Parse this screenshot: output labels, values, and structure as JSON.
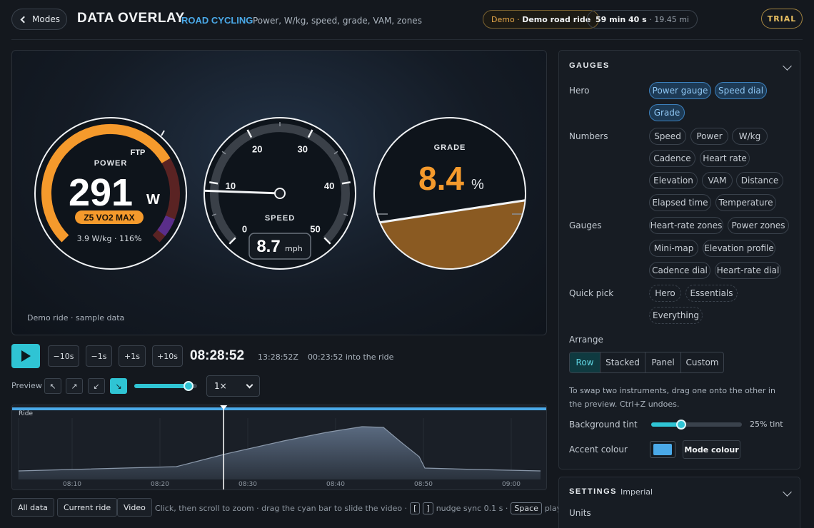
{
  "header": {
    "modes_label": "Modes",
    "title": "DATA OVERLAY",
    "sport": "ROAD CYCLING",
    "metrics": "Power, W/kg, speed, grade, VAM, zones",
    "demo_prefix": "Demo ·",
    "demo_name": "Demo road ride",
    "duration": "59 min 40 s",
    "distance": "· 19.45 mi",
    "trial": "TRIAL"
  },
  "preview": {
    "demo_note": "Demo ride · sample data",
    "power": {
      "label": "POWER",
      "ftp_label": "FTP",
      "value": "291",
      "unit": "W",
      "zone": "Z5 VO2 MAX",
      "detail": "3.9 W/kg · 116%",
      "fill_fraction": 0.72
    },
    "speed": {
      "label": "SPEED",
      "value": "8.7",
      "unit": "mph",
      "ticks": [
        "0",
        "10",
        "20",
        "30",
        "40",
        "50"
      ],
      "min": 0,
      "max": 50,
      "reading": 8.7
    },
    "grade": {
      "label": "GRADE",
      "value": "8.4",
      "unit": "%"
    }
  },
  "transport": {
    "back10": "−10s",
    "back1": "−1s",
    "fwd1": "+1s",
    "fwd10": "+10s",
    "clock": "08:28:52",
    "utc": "13:28:52Z",
    "into": "00:23:52 into the ride",
    "preview_label": "Preview",
    "positions": [
      "↖",
      "↗",
      "↙",
      "↘"
    ],
    "preview_size": 0.86,
    "speed_value": "1×"
  },
  "timeline": {
    "track_label": "Ride",
    "ticks": [
      "08:10",
      "08:20",
      "08:30",
      "08:40",
      "08:50",
      "09:00"
    ],
    "cursor_fraction": 0.395
  },
  "bottom": {
    "all_data": "All data",
    "current_ride": "Current ride",
    "video": "Video",
    "hint_a": "Click, then scroll to zoom · drag the cyan bar to slide the video ·",
    "key_open": "[",
    "key_close": "]",
    "hint_b": "nudge sync 0.1 s ·",
    "key_space": "Space",
    "hint_c": "play"
  },
  "gauges_panel": {
    "title": "GAUGES",
    "hero_label": "Hero",
    "hero": [
      "Power gauge",
      "Speed dial",
      "Grade"
    ],
    "numbers_label": "Numbers",
    "numbers": [
      "Speed",
      "Power",
      "W/kg",
      "Cadence",
      "Heart rate",
      "Elevation",
      "VAM",
      "Distance",
      "Elapsed time",
      "Temperature"
    ],
    "gauges_label": "Gauges",
    "gauges": [
      "Heart-rate zones",
      "Power zones",
      "Mini-map",
      "Elevation profile",
      "Cadence dial",
      "Heart-rate dial"
    ],
    "quick_label": "Quick pick",
    "quick": [
      "Hero",
      "Essentials",
      "Everything"
    ],
    "arrange_label": "Arrange",
    "arrange": [
      "Row",
      "Stacked",
      "Panel",
      "Custom"
    ],
    "note": "To swap two instruments, drag one onto the other in the preview. Ctrl+Z undoes.",
    "tint_label": "Background tint",
    "tint_value": "25% tint",
    "tint_fraction": 0.33,
    "accent_label": "Accent colour",
    "accent_color": "#4aa9e8",
    "mode_colour": "Mode colour"
  },
  "settings_panel": {
    "title": "SETTINGS",
    "subtitle": "Imperial",
    "units_label": "Units"
  }
}
